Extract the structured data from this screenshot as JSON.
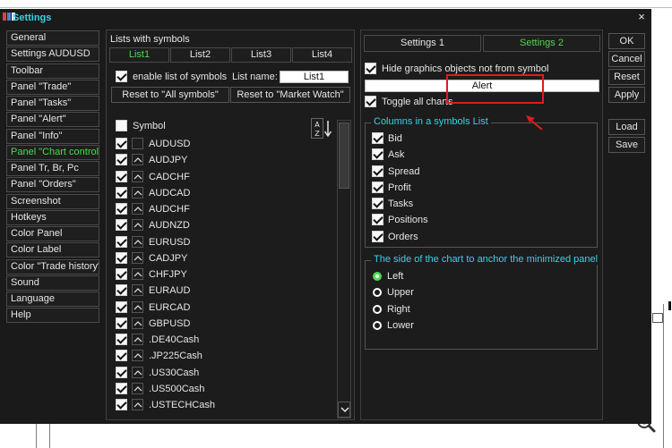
{
  "window": {
    "title": "Settings",
    "close_glyph": "×"
  },
  "nav": [
    {
      "label": "General"
    },
    {
      "label": "Settings AUDUSD"
    },
    {
      "label": "Toolbar"
    },
    {
      "label": "Panel \"Trade\""
    },
    {
      "label": "Panel \"Tasks\""
    },
    {
      "label": "Panel \"Alert\""
    },
    {
      "label": "Panel \"Info\""
    },
    {
      "label": "Panel \"Chart control\"",
      "active": true
    },
    {
      "label": "Panel Tr, Br, Pc"
    },
    {
      "label": "Panel \"Orders\""
    },
    {
      "label": "Screenshot"
    },
    {
      "label": "Hotkeys"
    },
    {
      "label": "Color Panel"
    },
    {
      "label": "Color Label"
    },
    {
      "label": "Color \"Trade history\""
    },
    {
      "label": "Sound"
    },
    {
      "label": "Language"
    },
    {
      "label": "Help"
    }
  ],
  "lists": {
    "title": "Lists with symbols",
    "tabs": [
      "List1",
      "List2",
      "List3",
      "List4"
    ],
    "active_tab": 0,
    "enable_label": "enable list of symbols",
    "list_name_label": "List name:",
    "list_name_value": "List1",
    "reset_all": "Reset to \"All symbols\"",
    "reset_watch": "Reset to \"Market Watch\"",
    "symbol_header": "Symbol",
    "sort_icon_text": "A Z",
    "symbols": [
      "AUDUSD",
      "AUDJPY",
      "CADCHF",
      "AUDCAD",
      "AUDCHF",
      "AUDNZD",
      "EURUSD",
      "CADJPY",
      "CHFJPY",
      "EURAUD",
      "EURCAD",
      "GBPUSD",
      ".DE40Cash",
      ".JP225Cash",
      ".US30Cash",
      ".US500Cash",
      ".USTECHCash"
    ]
  },
  "settings_tabs": [
    "Settings 1",
    "Settings 2"
  ],
  "active_settings_tab": 1,
  "options": {
    "hide_graphics": "Hide graphics objects not from symbol",
    "alert_value": "Alert",
    "toggle_all": "Toggle all charts"
  },
  "columns_group": {
    "title": "Columns in a symbols List",
    "items": [
      "Bid",
      "Ask",
      "Spread",
      "Profit",
      "Tasks",
      "Positions",
      "Orders"
    ]
  },
  "anchor_group": {
    "title": "The side of the chart to anchor the minimized panel",
    "items": [
      "Left",
      "Upper",
      "Right",
      "Lower"
    ],
    "selected": 0
  },
  "right_buttons": {
    "ok": "OK",
    "cancel": "Cancel",
    "reset": "Reset",
    "apply": "Apply",
    "load": "Load",
    "save": "Save"
  },
  "colors": {
    "accent_cyan": "#37d3e6",
    "accent_green": "#4fd84f",
    "highlight_red": "#e01b1b"
  }
}
